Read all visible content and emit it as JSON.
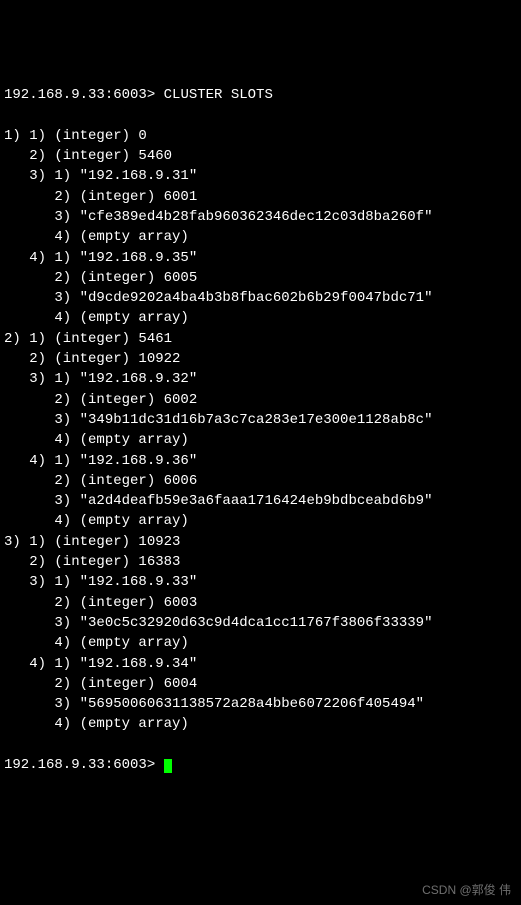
{
  "prompt_prefix": "192.168.9.33:6003>",
  "command": "CLUSTER SLOTS",
  "watermark": "CSDN @郭俊 伟",
  "slots": [
    {
      "start": 0,
      "end": 5460,
      "nodes": [
        {
          "ip": "192.168.9.31",
          "port": 6001,
          "id": "cfe389ed4b28fab960362346dec12c03d8ba260f",
          "extra": "(empty array)"
        },
        {
          "ip": "192.168.9.35",
          "port": 6005,
          "id": "d9cde9202a4ba4b3b8fbac602b6b29f0047bdc71",
          "extra": "(empty array)"
        }
      ]
    },
    {
      "start": 5461,
      "end": 10922,
      "nodes": [
        {
          "ip": "192.168.9.32",
          "port": 6002,
          "id": "349b11dc31d16b7a3c7ca283e17e300e1128ab8c",
          "extra": "(empty array)"
        },
        {
          "ip": "192.168.9.36",
          "port": 6006,
          "id": "a2d4deafb59e3a6faaa1716424eb9bdbceabd6b9",
          "extra": "(empty array)"
        }
      ]
    },
    {
      "start": 10923,
      "end": 16383,
      "nodes": [
        {
          "ip": "192.168.9.33",
          "port": 6003,
          "id": "3e0c5c32920d63c9d4dca1cc11767f3806f33339",
          "extra": "(empty array)"
        },
        {
          "ip": "192.168.9.34",
          "port": 6004,
          "id": "56950060631138572a28a4bbe6072206f405494",
          "extra": "(empty array)"
        }
      ]
    }
  ]
}
